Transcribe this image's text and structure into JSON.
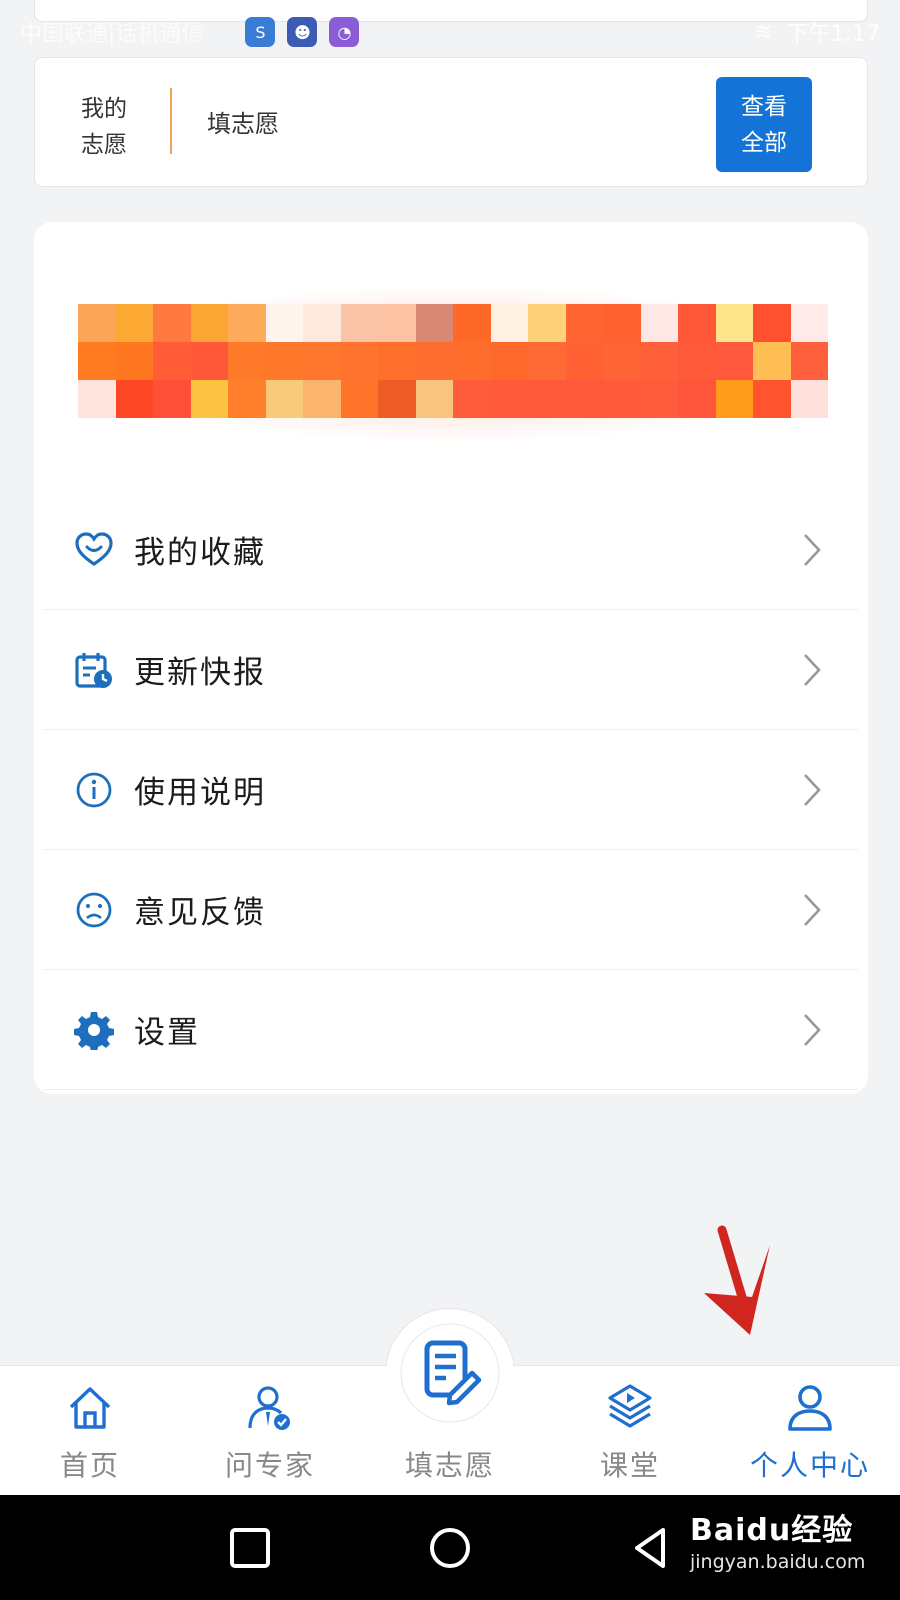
{
  "status_bar": {
    "carrier": "中国联通|话机通信",
    "time": "下午1:17"
  },
  "volunteer_card": {
    "label_line1": "我的",
    "label_line2": "志愿",
    "fill_text": "填志愿",
    "view_all_line1": "查看",
    "view_all_line2": "全部",
    "accent_color": "#1473d6"
  },
  "menu": {
    "items": [
      {
        "label": "我的收藏",
        "icon": "heart-icon"
      },
      {
        "label": "更新快报",
        "icon": "calendar-clock-icon"
      },
      {
        "label": "使用说明",
        "icon": "info-icon"
      },
      {
        "label": "意见反馈",
        "icon": "sad-face-icon"
      },
      {
        "label": "设置",
        "icon": "gear-icon"
      }
    ]
  },
  "bottom_nav": {
    "items": [
      {
        "label": "首页",
        "icon": "home-icon",
        "active": false
      },
      {
        "label": "问专家",
        "icon": "expert-icon",
        "active": false
      },
      {
        "label": "填志愿",
        "icon": "fill-form-icon",
        "active": false
      },
      {
        "label": "课堂",
        "icon": "classroom-icon",
        "active": false
      },
      {
        "label": "个人中心",
        "icon": "user-icon",
        "active": true
      }
    ],
    "active_color": "#1f6fd1"
  },
  "watermark": {
    "main": "Baidu经验",
    "sub": "jingyan.baidu.com"
  }
}
